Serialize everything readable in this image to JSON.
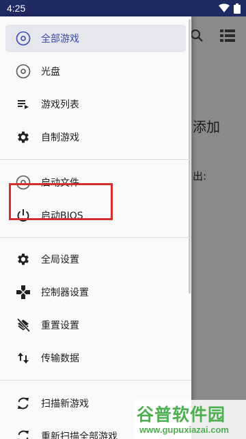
{
  "status_bar": {
    "time": "4:25"
  },
  "background": {
    "text_1": "添加",
    "text_2": "出:"
  },
  "drawer": {
    "items": [
      {
        "label": "全部游戏",
        "icon": "disc-icon",
        "selected": true
      },
      {
        "label": "光盘",
        "icon": "disc-icon"
      },
      {
        "label": "游戏列表",
        "icon": "playlist-icon"
      },
      {
        "label": "自制游戏",
        "icon": "gear-icon"
      },
      {
        "label": "启动文件",
        "icon": "disc-icon"
      },
      {
        "label": "启动BIOS",
        "icon": "power-icon"
      },
      {
        "label": "全局设置",
        "icon": "gear-icon"
      },
      {
        "label": "控制器设置",
        "icon": "gamepad-icon"
      },
      {
        "label": "重置设置",
        "icon": "layers-off-icon"
      },
      {
        "label": "传输数据",
        "icon": "swap-vertical-icon"
      },
      {
        "label": "扫描新游戏",
        "icon": "refresh-icon"
      },
      {
        "label": "重新扫描全部游戏",
        "icon": "refresh-icon"
      }
    ]
  },
  "highlight_color": "#d32f2f",
  "accent_color": "#3949ab",
  "watermark": {
    "title": "谷普软件园",
    "url": "www.gupuxiazai.com"
  }
}
